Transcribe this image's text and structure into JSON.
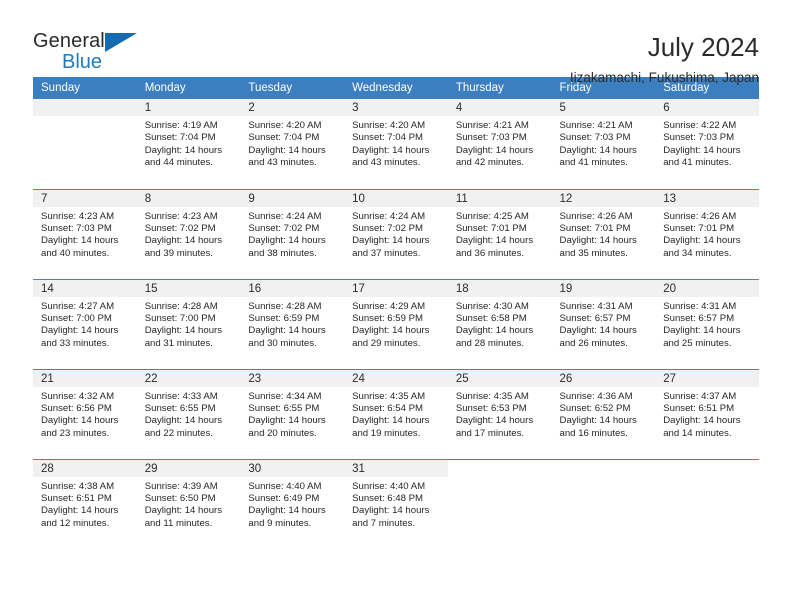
{
  "brand": {
    "word1": "General",
    "word2": "Blue",
    "triangle_color": "#156CB0",
    "blue_text_color": "#1F7AC0"
  },
  "header": {
    "title": "July 2024",
    "subtitle": "Iizakamachi, Fukushima, Japan",
    "header_bg": "#3C7FC0",
    "daynum_bg": "#F1F1F1",
    "row_divider": "#4A82BD"
  },
  "weekday_headers": [
    "Sunday",
    "Monday",
    "Tuesday",
    "Wednesday",
    "Thursday",
    "Friday",
    "Saturday"
  ],
  "labels": {
    "sunrise_prefix": "Sunrise:",
    "sunset_prefix": "Sunset:",
    "daylight_prefix": "Daylight:"
  },
  "calendar_data": {
    "month": "July",
    "year": 2024,
    "location": "Iizakamachi, Fukushima, Japan",
    "weeks": [
      [
        {
          "day": "",
          "empty": true
        },
        {
          "day": "1",
          "sunrise": "Sunrise: 4:19 AM",
          "sunset": "Sunset: 7:04 PM",
          "daylight_1": "Daylight: 14 hours",
          "daylight_2": "and 44 minutes."
        },
        {
          "day": "2",
          "sunrise": "Sunrise: 4:20 AM",
          "sunset": "Sunset: 7:04 PM",
          "daylight_1": "Daylight: 14 hours",
          "daylight_2": "and 43 minutes."
        },
        {
          "day": "3",
          "sunrise": "Sunrise: 4:20 AM",
          "sunset": "Sunset: 7:04 PM",
          "daylight_1": "Daylight: 14 hours",
          "daylight_2": "and 43 minutes."
        },
        {
          "day": "4",
          "sunrise": "Sunrise: 4:21 AM",
          "sunset": "Sunset: 7:03 PM",
          "daylight_1": "Daylight: 14 hours",
          "daylight_2": "and 42 minutes."
        },
        {
          "day": "5",
          "sunrise": "Sunrise: 4:21 AM",
          "sunset": "Sunset: 7:03 PM",
          "daylight_1": "Daylight: 14 hours",
          "daylight_2": "and 41 minutes."
        },
        {
          "day": "6",
          "sunrise": "Sunrise: 4:22 AM",
          "sunset": "Sunset: 7:03 PM",
          "daylight_1": "Daylight: 14 hours",
          "daylight_2": "and 41 minutes."
        }
      ],
      [
        {
          "day": "7",
          "sunrise": "Sunrise: 4:23 AM",
          "sunset": "Sunset: 7:03 PM",
          "daylight_1": "Daylight: 14 hours",
          "daylight_2": "and 40 minutes."
        },
        {
          "day": "8",
          "sunrise": "Sunrise: 4:23 AM",
          "sunset": "Sunset: 7:02 PM",
          "daylight_1": "Daylight: 14 hours",
          "daylight_2": "and 39 minutes."
        },
        {
          "day": "9",
          "sunrise": "Sunrise: 4:24 AM",
          "sunset": "Sunset: 7:02 PM",
          "daylight_1": "Daylight: 14 hours",
          "daylight_2": "and 38 minutes."
        },
        {
          "day": "10",
          "sunrise": "Sunrise: 4:24 AM",
          "sunset": "Sunset: 7:02 PM",
          "daylight_1": "Daylight: 14 hours",
          "daylight_2": "and 37 minutes."
        },
        {
          "day": "11",
          "sunrise": "Sunrise: 4:25 AM",
          "sunset": "Sunset: 7:01 PM",
          "daylight_1": "Daylight: 14 hours",
          "daylight_2": "and 36 minutes."
        },
        {
          "day": "12",
          "sunrise": "Sunrise: 4:26 AM",
          "sunset": "Sunset: 7:01 PM",
          "daylight_1": "Daylight: 14 hours",
          "daylight_2": "and 35 minutes."
        },
        {
          "day": "13",
          "sunrise": "Sunrise: 4:26 AM",
          "sunset": "Sunset: 7:01 PM",
          "daylight_1": "Daylight: 14 hours",
          "daylight_2": "and 34 minutes."
        }
      ],
      [
        {
          "day": "14",
          "sunrise": "Sunrise: 4:27 AM",
          "sunset": "Sunset: 7:00 PM",
          "daylight_1": "Daylight: 14 hours",
          "daylight_2": "and 33 minutes."
        },
        {
          "day": "15",
          "sunrise": "Sunrise: 4:28 AM",
          "sunset": "Sunset: 7:00 PM",
          "daylight_1": "Daylight: 14 hours",
          "daylight_2": "and 31 minutes."
        },
        {
          "day": "16",
          "sunrise": "Sunrise: 4:28 AM",
          "sunset": "Sunset: 6:59 PM",
          "daylight_1": "Daylight: 14 hours",
          "daylight_2": "and 30 minutes."
        },
        {
          "day": "17",
          "sunrise": "Sunrise: 4:29 AM",
          "sunset": "Sunset: 6:59 PM",
          "daylight_1": "Daylight: 14 hours",
          "daylight_2": "and 29 minutes."
        },
        {
          "day": "18",
          "sunrise": "Sunrise: 4:30 AM",
          "sunset": "Sunset: 6:58 PM",
          "daylight_1": "Daylight: 14 hours",
          "daylight_2": "and 28 minutes."
        },
        {
          "day": "19",
          "sunrise": "Sunrise: 4:31 AM",
          "sunset": "Sunset: 6:57 PM",
          "daylight_1": "Daylight: 14 hours",
          "daylight_2": "and 26 minutes."
        },
        {
          "day": "20",
          "sunrise": "Sunrise: 4:31 AM",
          "sunset": "Sunset: 6:57 PM",
          "daylight_1": "Daylight: 14 hours",
          "daylight_2": "and 25 minutes."
        }
      ],
      [
        {
          "day": "21",
          "sunrise": "Sunrise: 4:32 AM",
          "sunset": "Sunset: 6:56 PM",
          "daylight_1": "Daylight: 14 hours",
          "daylight_2": "and 23 minutes."
        },
        {
          "day": "22",
          "sunrise": "Sunrise: 4:33 AM",
          "sunset": "Sunset: 6:55 PM",
          "daylight_1": "Daylight: 14 hours",
          "daylight_2": "and 22 minutes."
        },
        {
          "day": "23",
          "sunrise": "Sunrise: 4:34 AM",
          "sunset": "Sunset: 6:55 PM",
          "daylight_1": "Daylight: 14 hours",
          "daylight_2": "and 20 minutes."
        },
        {
          "day": "24",
          "sunrise": "Sunrise: 4:35 AM",
          "sunset": "Sunset: 6:54 PM",
          "daylight_1": "Daylight: 14 hours",
          "daylight_2": "and 19 minutes."
        },
        {
          "day": "25",
          "sunrise": "Sunrise: 4:35 AM",
          "sunset": "Sunset: 6:53 PM",
          "daylight_1": "Daylight: 14 hours",
          "daylight_2": "and 17 minutes."
        },
        {
          "day": "26",
          "sunrise": "Sunrise: 4:36 AM",
          "sunset": "Sunset: 6:52 PM",
          "daylight_1": "Daylight: 14 hours",
          "daylight_2": "and 16 minutes."
        },
        {
          "day": "27",
          "sunrise": "Sunrise: 4:37 AM",
          "sunset": "Sunset: 6:51 PM",
          "daylight_1": "Daylight: 14 hours",
          "daylight_2": "and 14 minutes."
        }
      ],
      [
        {
          "day": "28",
          "sunrise": "Sunrise: 4:38 AM",
          "sunset": "Sunset: 6:51 PM",
          "daylight_1": "Daylight: 14 hours",
          "daylight_2": "and 12 minutes."
        },
        {
          "day": "29",
          "sunrise": "Sunrise: 4:39 AM",
          "sunset": "Sunset: 6:50 PM",
          "daylight_1": "Daylight: 14 hours",
          "daylight_2": "and 11 minutes."
        },
        {
          "day": "30",
          "sunrise": "Sunrise: 4:40 AM",
          "sunset": "Sunset: 6:49 PM",
          "daylight_1": "Daylight: 14 hours",
          "daylight_2": "and 9 minutes."
        },
        {
          "day": "31",
          "sunrise": "Sunrise: 4:40 AM",
          "sunset": "Sunset: 6:48 PM",
          "daylight_1": "Daylight: 14 hours",
          "daylight_2": "and 7 minutes."
        },
        {
          "day": "",
          "empty": true,
          "blank": true
        },
        {
          "day": "",
          "empty": true,
          "blank": true
        },
        {
          "day": "",
          "empty": true,
          "blank": true
        }
      ]
    ]
  }
}
